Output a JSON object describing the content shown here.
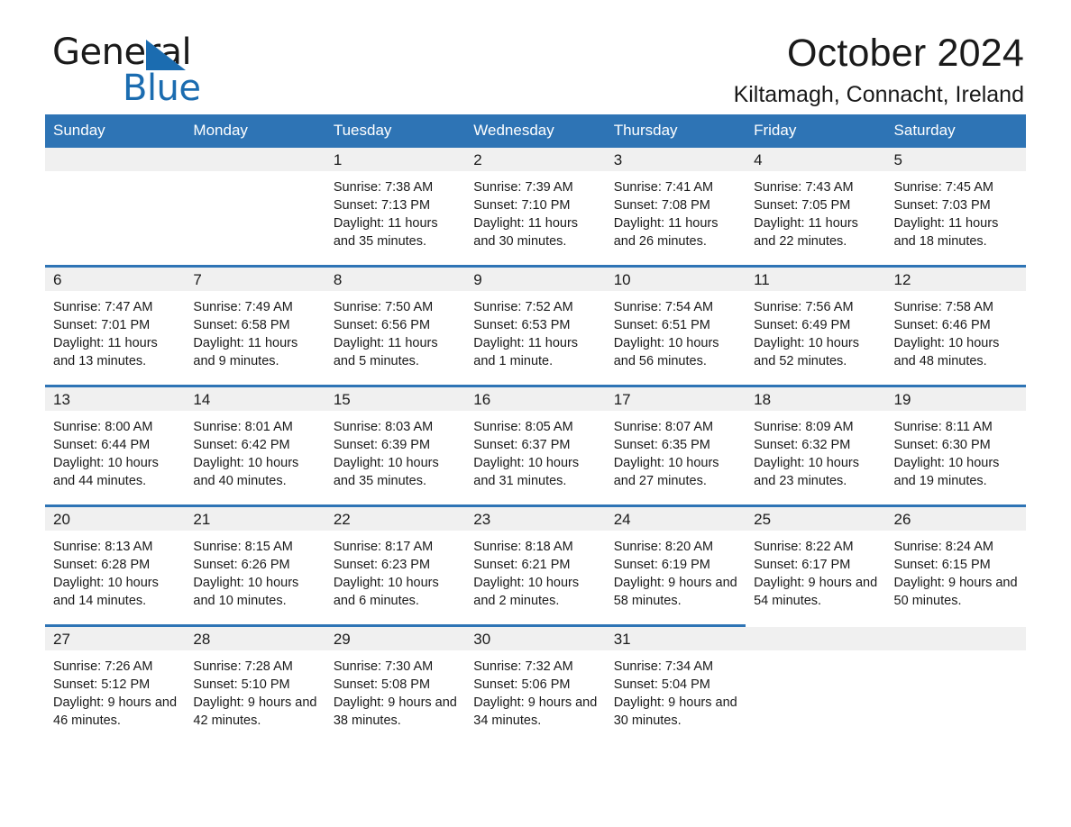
{
  "brand": {
    "word1": "General",
    "word2": "Blue",
    "accent_color": "#1B6CB0",
    "triangle_icon": "triangle-icon"
  },
  "header": {
    "title": "October 2024",
    "location": "Kiltamagh, Connacht, Ireland"
  },
  "calendar": {
    "header_color": "#2E74B5",
    "daynum_band_color": "#F0F0F0",
    "weekday_headers": [
      "Sunday",
      "Monday",
      "Tuesday",
      "Wednesday",
      "Thursday",
      "Friday",
      "Saturday"
    ],
    "weeks": [
      [
        {
          "day": "",
          "blank": true
        },
        {
          "day": "",
          "blank": true
        },
        {
          "day": "1",
          "sunrise": "Sunrise: 7:38 AM",
          "sunset": "Sunset: 7:13 PM",
          "daylight": "Daylight: 11 hours and 35 minutes."
        },
        {
          "day": "2",
          "sunrise": "Sunrise: 7:39 AM",
          "sunset": "Sunset: 7:10 PM",
          "daylight": "Daylight: 11 hours and 30 minutes."
        },
        {
          "day": "3",
          "sunrise": "Sunrise: 7:41 AM",
          "sunset": "Sunset: 7:08 PM",
          "daylight": "Daylight: 11 hours and 26 minutes."
        },
        {
          "day": "4",
          "sunrise": "Sunrise: 7:43 AM",
          "sunset": "Sunset: 7:05 PM",
          "daylight": "Daylight: 11 hours and 22 minutes."
        },
        {
          "day": "5",
          "sunrise": "Sunrise: 7:45 AM",
          "sunset": "Sunset: 7:03 PM",
          "daylight": "Daylight: 11 hours and 18 minutes."
        }
      ],
      [
        {
          "day": "6",
          "sunrise": "Sunrise: 7:47 AM",
          "sunset": "Sunset: 7:01 PM",
          "daylight": "Daylight: 11 hours and 13 minutes."
        },
        {
          "day": "7",
          "sunrise": "Sunrise: 7:49 AM",
          "sunset": "Sunset: 6:58 PM",
          "daylight": "Daylight: 11 hours and 9 minutes."
        },
        {
          "day": "8",
          "sunrise": "Sunrise: 7:50 AM",
          "sunset": "Sunset: 6:56 PM",
          "daylight": "Daylight: 11 hours and 5 minutes."
        },
        {
          "day": "9",
          "sunrise": "Sunrise: 7:52 AM",
          "sunset": "Sunset: 6:53 PM",
          "daylight": "Daylight: 11 hours and 1 minute."
        },
        {
          "day": "10",
          "sunrise": "Sunrise: 7:54 AM",
          "sunset": "Sunset: 6:51 PM",
          "daylight": "Daylight: 10 hours and 56 minutes."
        },
        {
          "day": "11",
          "sunrise": "Sunrise: 7:56 AM",
          "sunset": "Sunset: 6:49 PM",
          "daylight": "Daylight: 10 hours and 52 minutes."
        },
        {
          "day": "12",
          "sunrise": "Sunrise: 7:58 AM",
          "sunset": "Sunset: 6:46 PM",
          "daylight": "Daylight: 10 hours and 48 minutes."
        }
      ],
      [
        {
          "day": "13",
          "sunrise": "Sunrise: 8:00 AM",
          "sunset": "Sunset: 6:44 PM",
          "daylight": "Daylight: 10 hours and 44 minutes."
        },
        {
          "day": "14",
          "sunrise": "Sunrise: 8:01 AM",
          "sunset": "Sunset: 6:42 PM",
          "daylight": "Daylight: 10 hours and 40 minutes."
        },
        {
          "day": "15",
          "sunrise": "Sunrise: 8:03 AM",
          "sunset": "Sunset: 6:39 PM",
          "daylight": "Daylight: 10 hours and 35 minutes."
        },
        {
          "day": "16",
          "sunrise": "Sunrise: 8:05 AM",
          "sunset": "Sunset: 6:37 PM",
          "daylight": "Daylight: 10 hours and 31 minutes."
        },
        {
          "day": "17",
          "sunrise": "Sunrise: 8:07 AM",
          "sunset": "Sunset: 6:35 PM",
          "daylight": "Daylight: 10 hours and 27 minutes."
        },
        {
          "day": "18",
          "sunrise": "Sunrise: 8:09 AM",
          "sunset": "Sunset: 6:32 PM",
          "daylight": "Daylight: 10 hours and 23 minutes."
        },
        {
          "day": "19",
          "sunrise": "Sunrise: 8:11 AM",
          "sunset": "Sunset: 6:30 PM",
          "daylight": "Daylight: 10 hours and 19 minutes."
        }
      ],
      [
        {
          "day": "20",
          "sunrise": "Sunrise: 8:13 AM",
          "sunset": "Sunset: 6:28 PM",
          "daylight": "Daylight: 10 hours and 14 minutes."
        },
        {
          "day": "21",
          "sunrise": "Sunrise: 8:15 AM",
          "sunset": "Sunset: 6:26 PM",
          "daylight": "Daylight: 10 hours and 10 minutes."
        },
        {
          "day": "22",
          "sunrise": "Sunrise: 8:17 AM",
          "sunset": "Sunset: 6:23 PM",
          "daylight": "Daylight: 10 hours and 6 minutes."
        },
        {
          "day": "23",
          "sunrise": "Sunrise: 8:18 AM",
          "sunset": "Sunset: 6:21 PM",
          "daylight": "Daylight: 10 hours and 2 minutes."
        },
        {
          "day": "24",
          "sunrise": "Sunrise: 8:20 AM",
          "sunset": "Sunset: 6:19 PM",
          "daylight": "Daylight: 9 hours and 58 minutes."
        },
        {
          "day": "25",
          "sunrise": "Sunrise: 8:22 AM",
          "sunset": "Sunset: 6:17 PM",
          "daylight": "Daylight: 9 hours and 54 minutes."
        },
        {
          "day": "26",
          "sunrise": "Sunrise: 8:24 AM",
          "sunset": "Sunset: 6:15 PM",
          "daylight": "Daylight: 9 hours and 50 minutes."
        }
      ],
      [
        {
          "day": "27",
          "sunrise": "Sunrise: 7:26 AM",
          "sunset": "Sunset: 5:12 PM",
          "daylight": "Daylight: 9 hours and 46 minutes."
        },
        {
          "day": "28",
          "sunrise": "Sunrise: 7:28 AM",
          "sunset": "Sunset: 5:10 PM",
          "daylight": "Daylight: 9 hours and 42 minutes."
        },
        {
          "day": "29",
          "sunrise": "Sunrise: 7:30 AM",
          "sunset": "Sunset: 5:08 PM",
          "daylight": "Daylight: 9 hours and 38 minutes."
        },
        {
          "day": "30",
          "sunrise": "Sunrise: 7:32 AM",
          "sunset": "Sunset: 5:06 PM",
          "daylight": "Daylight: 9 hours and 34 minutes."
        },
        {
          "day": "31",
          "sunrise": "Sunrise: 7:34 AM",
          "sunset": "Sunset: 5:04 PM",
          "daylight": "Daylight: 9 hours and 30 minutes."
        },
        {
          "day": "",
          "blank": true
        },
        {
          "day": "",
          "blank": true
        }
      ]
    ]
  }
}
